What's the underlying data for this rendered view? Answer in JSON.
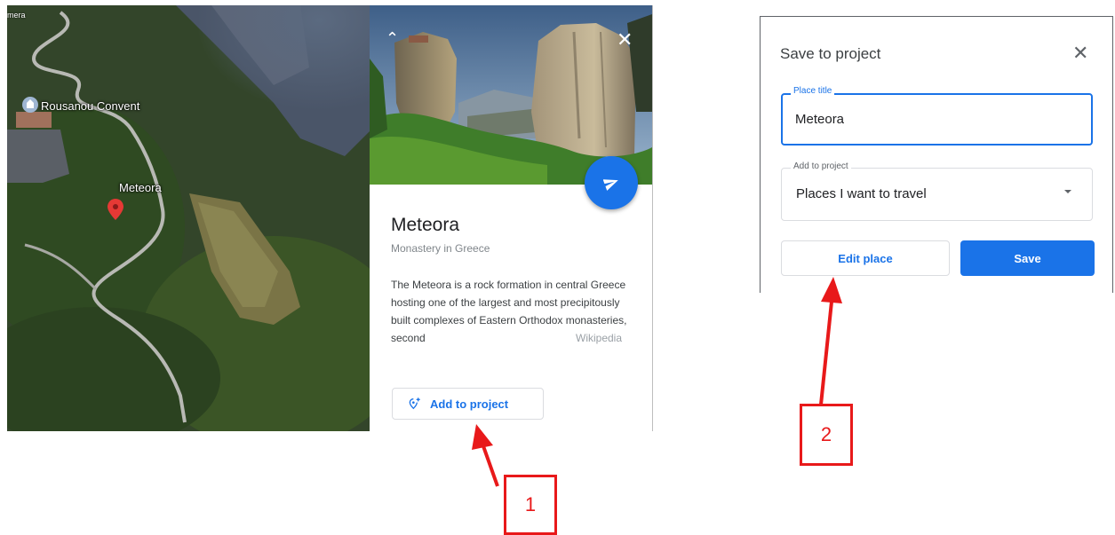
{
  "map": {
    "corner_label": "mera",
    "places": [
      {
        "label": "Rousanou Convent",
        "icon": "place-pin-icon"
      },
      {
        "label": "Meteora",
        "icon": "red-pin-icon"
      }
    ]
  },
  "card": {
    "title": "Meteora",
    "subtitle": "Monastery in Greece",
    "description": "The Meteora is a rock formation in central Greece hosting one of the largest and most precipitously built complexes of Eastern Orthodox monasteries, second",
    "source": "Wikipedia",
    "add_to_project_label": "Add to project",
    "collapse_icon": "chevron-up-icon",
    "close_icon": "close-icon",
    "fab_icon": "send-icon"
  },
  "dialog": {
    "title": "Save to project",
    "place_title_label": "Place title",
    "place_title_value": "Meteora",
    "add_to_project_label": "Add to project",
    "add_to_project_value": "Places I want to travel",
    "edit_button": "Edit place",
    "save_button": "Save"
  },
  "annotations": {
    "step1": "1",
    "step2": "2",
    "color": "#e8191a"
  },
  "colors": {
    "accent": "#1a73e8"
  }
}
